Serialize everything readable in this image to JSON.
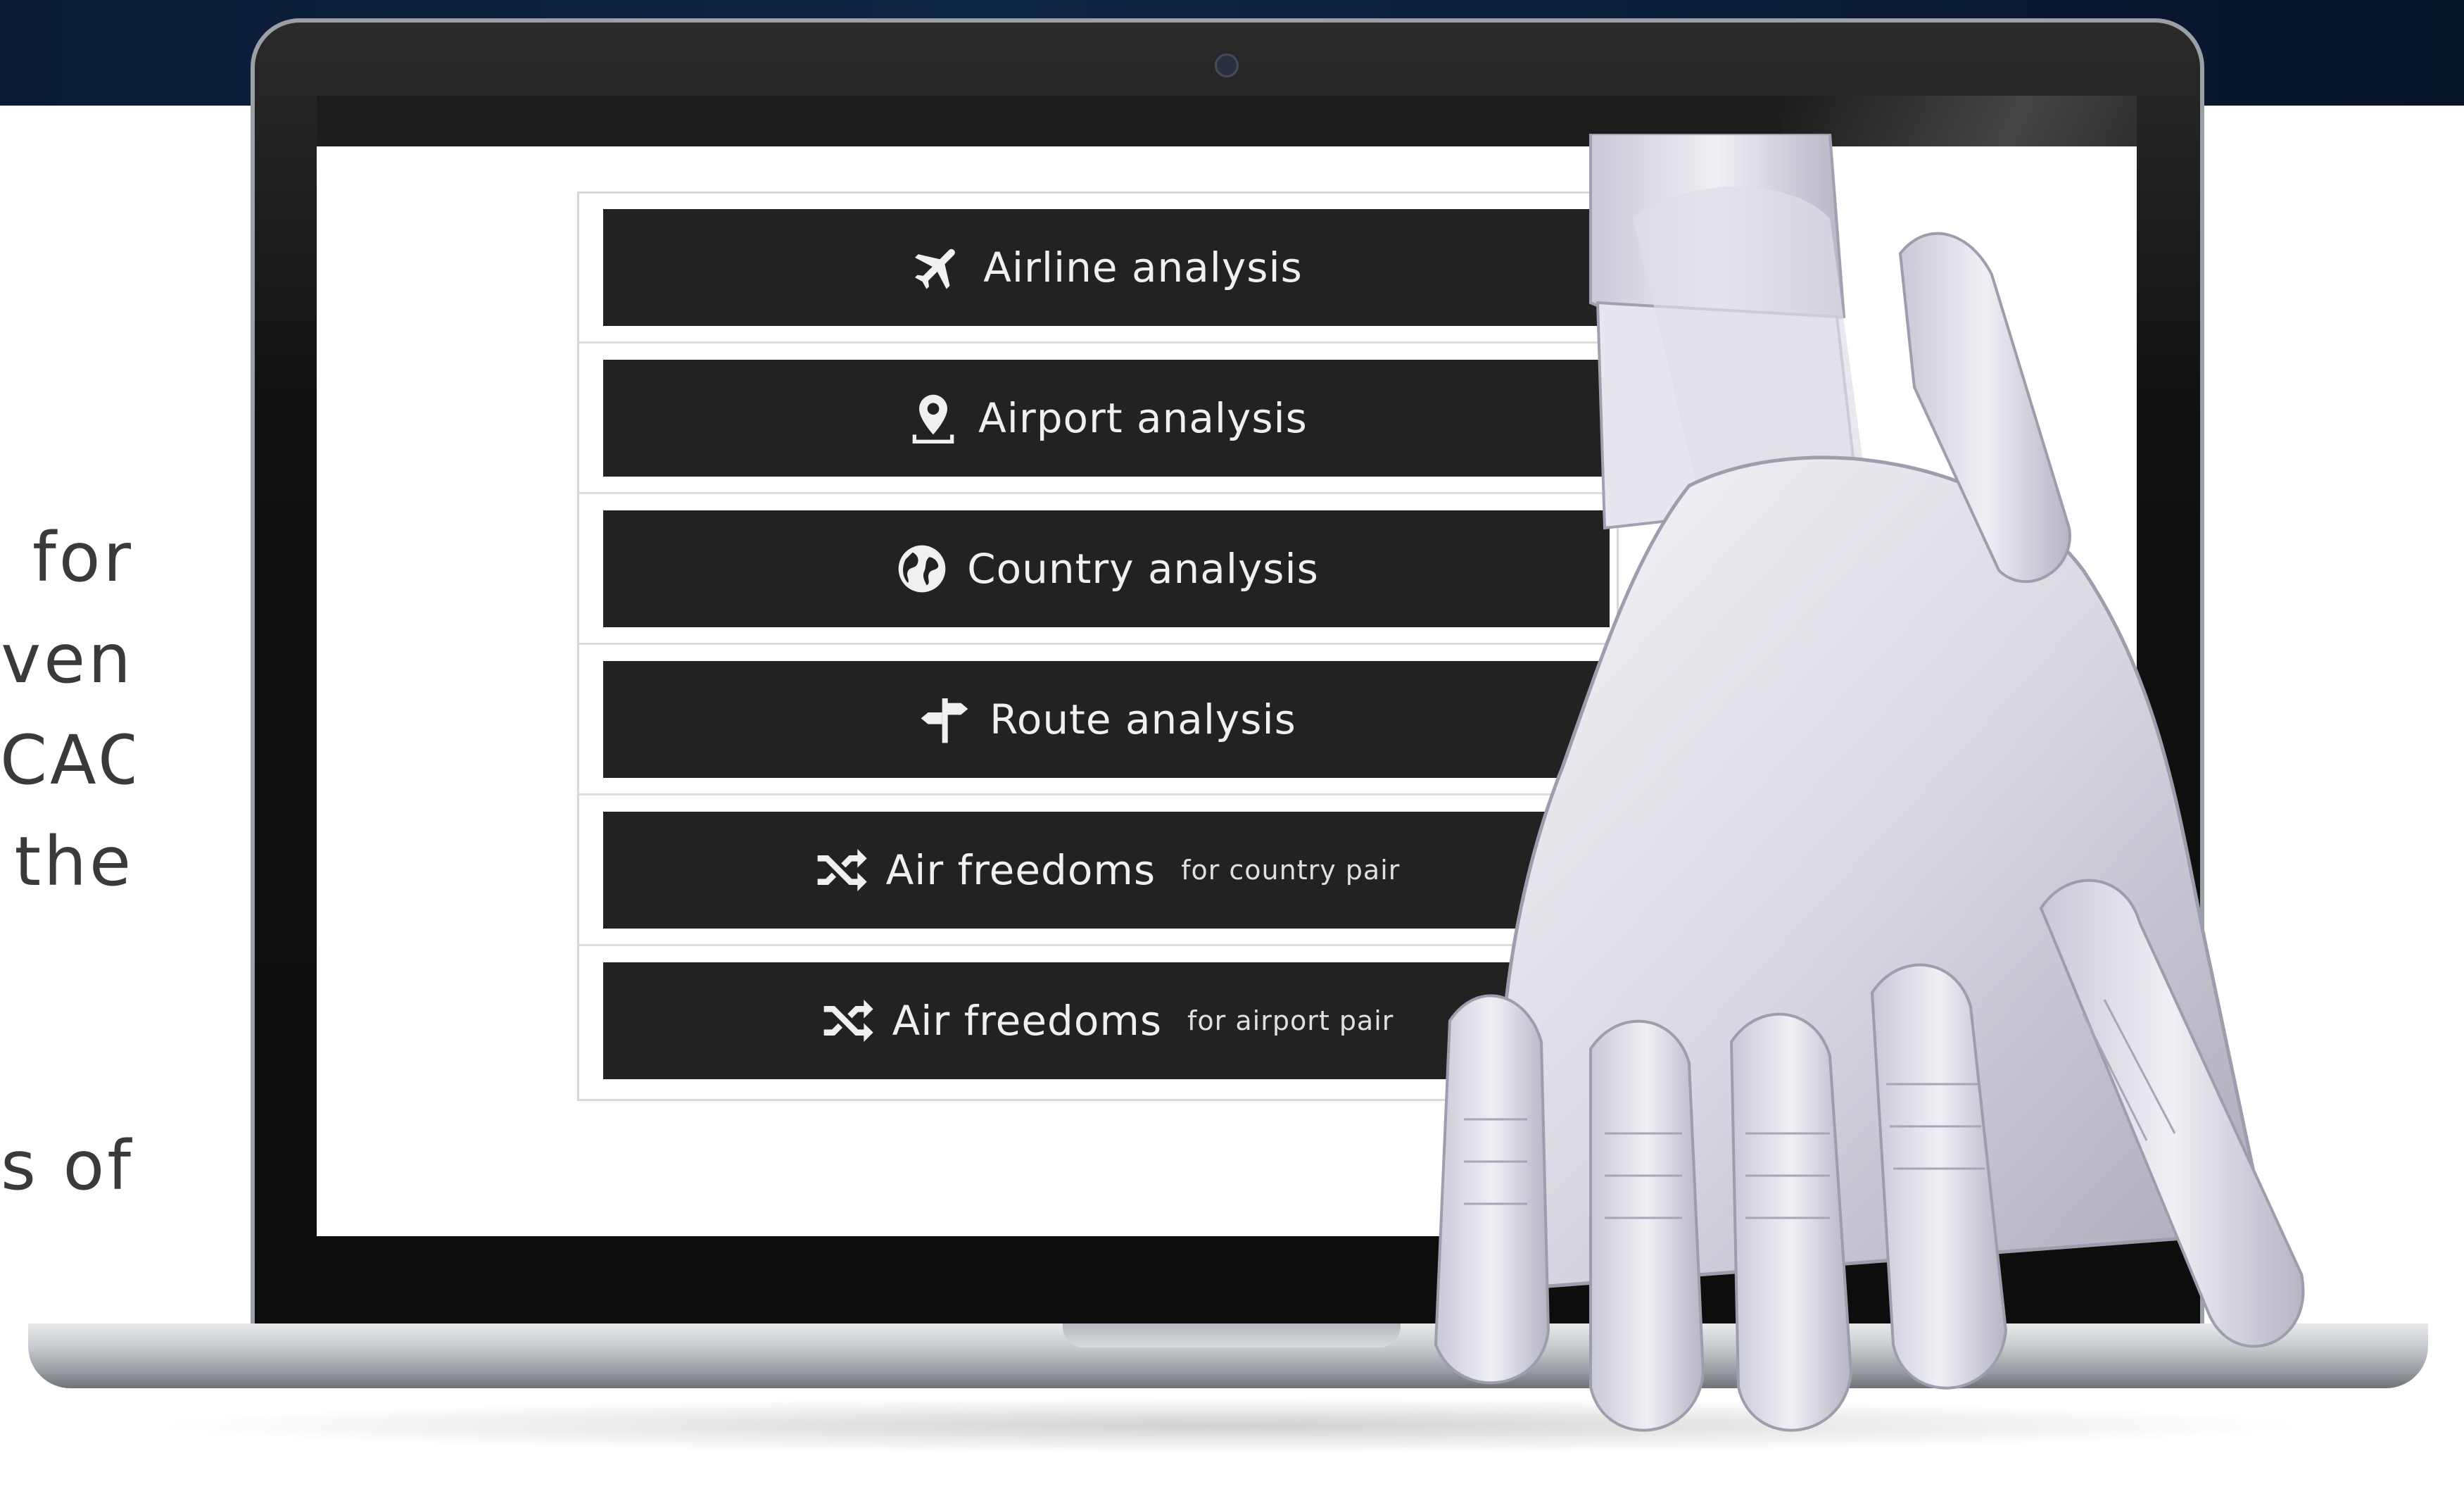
{
  "side_text": {
    "lines": [
      "for",
      "ven",
      "CAO",
      "the",
      "s of"
    ]
  },
  "menu": {
    "items": [
      {
        "label": "Airline analysis",
        "icon": "airplane-icon"
      },
      {
        "label": "Airport analysis",
        "icon": "map-pin-icon"
      },
      {
        "label": "Country analysis",
        "icon": "globe-icon"
      },
      {
        "label": "Route analysis",
        "icon": "signpost-icon"
      },
      {
        "label": "Air freedoms",
        "sub": "for country pair",
        "icon": "shuffle-icon"
      },
      {
        "label": "Air freedoms",
        "sub": "for airport pair",
        "icon": "shuffle-icon"
      }
    ]
  },
  "colors": {
    "button_bg": "#222222",
    "button_text": "#f0f0f0",
    "top_band": "#0e2646"
  }
}
